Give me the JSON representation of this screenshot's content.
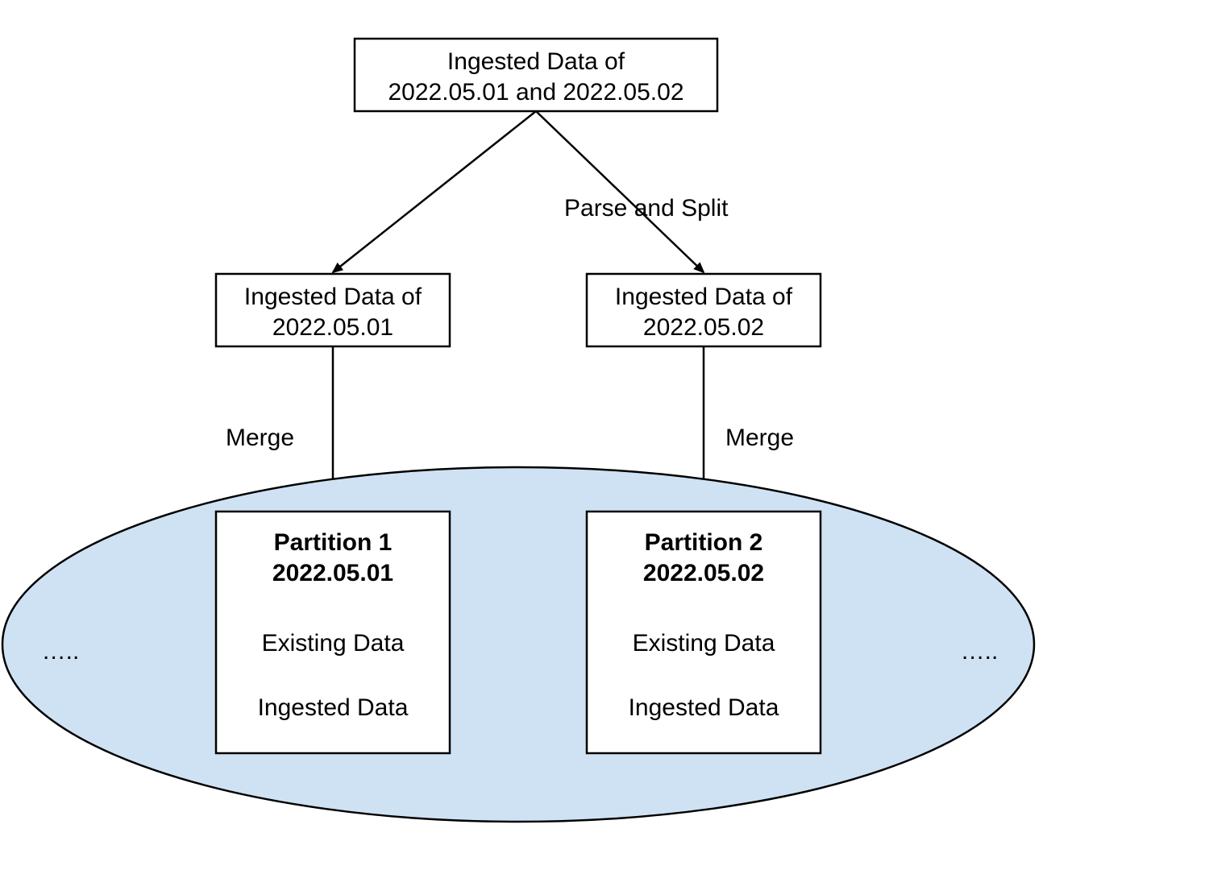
{
  "top_box": {
    "line1": "Ingested Data of",
    "line2": "2022.05.01 and 2022.05.02"
  },
  "split_label": "Parse and Split",
  "left_mid_box": {
    "line1": "Ingested Data  of",
    "line2": "2022.05.01"
  },
  "right_mid_box": {
    "line1": "Ingested Data  of",
    "line2": "2022.05.02"
  },
  "merge_label_left": "Merge",
  "merge_label_right": "Merge",
  "partition1": {
    "title": "Partition 1",
    "date": "2022.05.01",
    "existing": "Existing Data",
    "ingested": "Ingested Data"
  },
  "partition2": {
    "title": "Partition 2",
    "date": "2022.05.02",
    "existing": "Existing Data",
    "ingested": "Ingested Data"
  },
  "ellipsis_left": "…..",
  "ellipsis_right": "….."
}
